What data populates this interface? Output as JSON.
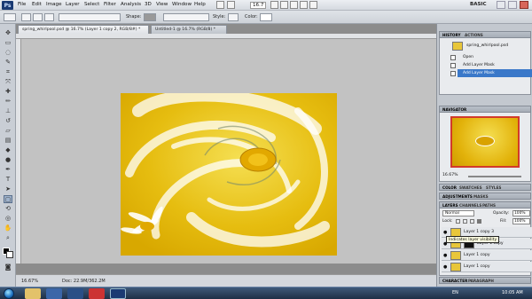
{
  "app": {
    "logo": "Ps",
    "menu": [
      "File",
      "Edit",
      "Image",
      "Layer",
      "Select",
      "Filter",
      "Analysis",
      "3D",
      "View",
      "Window",
      "Help"
    ],
    "workspace": "BASIC",
    "zoom_dropdown": "16.7"
  },
  "options": {
    "shape_label": "Shape:",
    "style_label": "Style:",
    "color_label": "Color:"
  },
  "document": {
    "tabs": [
      {
        "label": "spring_whirlpool.psd @ 16.7% (Layer 1 copy 2, RGB/8#) *",
        "active": true
      },
      {
        "label": "Untitled-1 @ 16.7% (RGB/8) *",
        "active": false
      }
    ],
    "zoom": "16.67%",
    "doc_info": "Doc: 22.9M/362.2M"
  },
  "panels": {
    "history": {
      "tabs": [
        "HISTORY",
        "ACTIONS"
      ],
      "snapshot": "spring_whirlpool.psd",
      "items": [
        {
          "label": "Open",
          "selected": false
        },
        {
          "label": "Add Layer Mask",
          "selected": false
        },
        {
          "label": "Add Layer Mask",
          "selected": true
        }
      ]
    },
    "navigator": {
      "tabs": [
        "NAVIGATOR"
      ],
      "zoom": "16.67%"
    },
    "color_tabs": [
      "COLOR",
      "SWATCHES",
      "STYLES"
    ],
    "adjust_tabs": [
      "ADJUSTMENTS",
      "MASKS"
    ],
    "layers": {
      "tabs": [
        "LAYERS",
        "CHANNELS",
        "PATHS"
      ],
      "blend_mode": "Normal",
      "opacity_label": "Opacity:",
      "opacity": "100%",
      "fill_label": "Fill:",
      "fill": "100%",
      "lock_label": "Lock:",
      "rows": [
        "Layer 1 copy 3",
        "Layer 1 copy",
        "Layer 1 copy",
        "Layer 1 copy"
      ],
      "tooltip": "Indicates layer visibility"
    },
    "bottom_tabs": [
      "CHARACTER",
      "PARAGRAPH"
    ]
  },
  "taskbar": {
    "lang": "EN",
    "time": "10:05 AM"
  },
  "colors": {
    "accent": "#3a78c9",
    "canvas_yellow": "#e8c21a"
  }
}
